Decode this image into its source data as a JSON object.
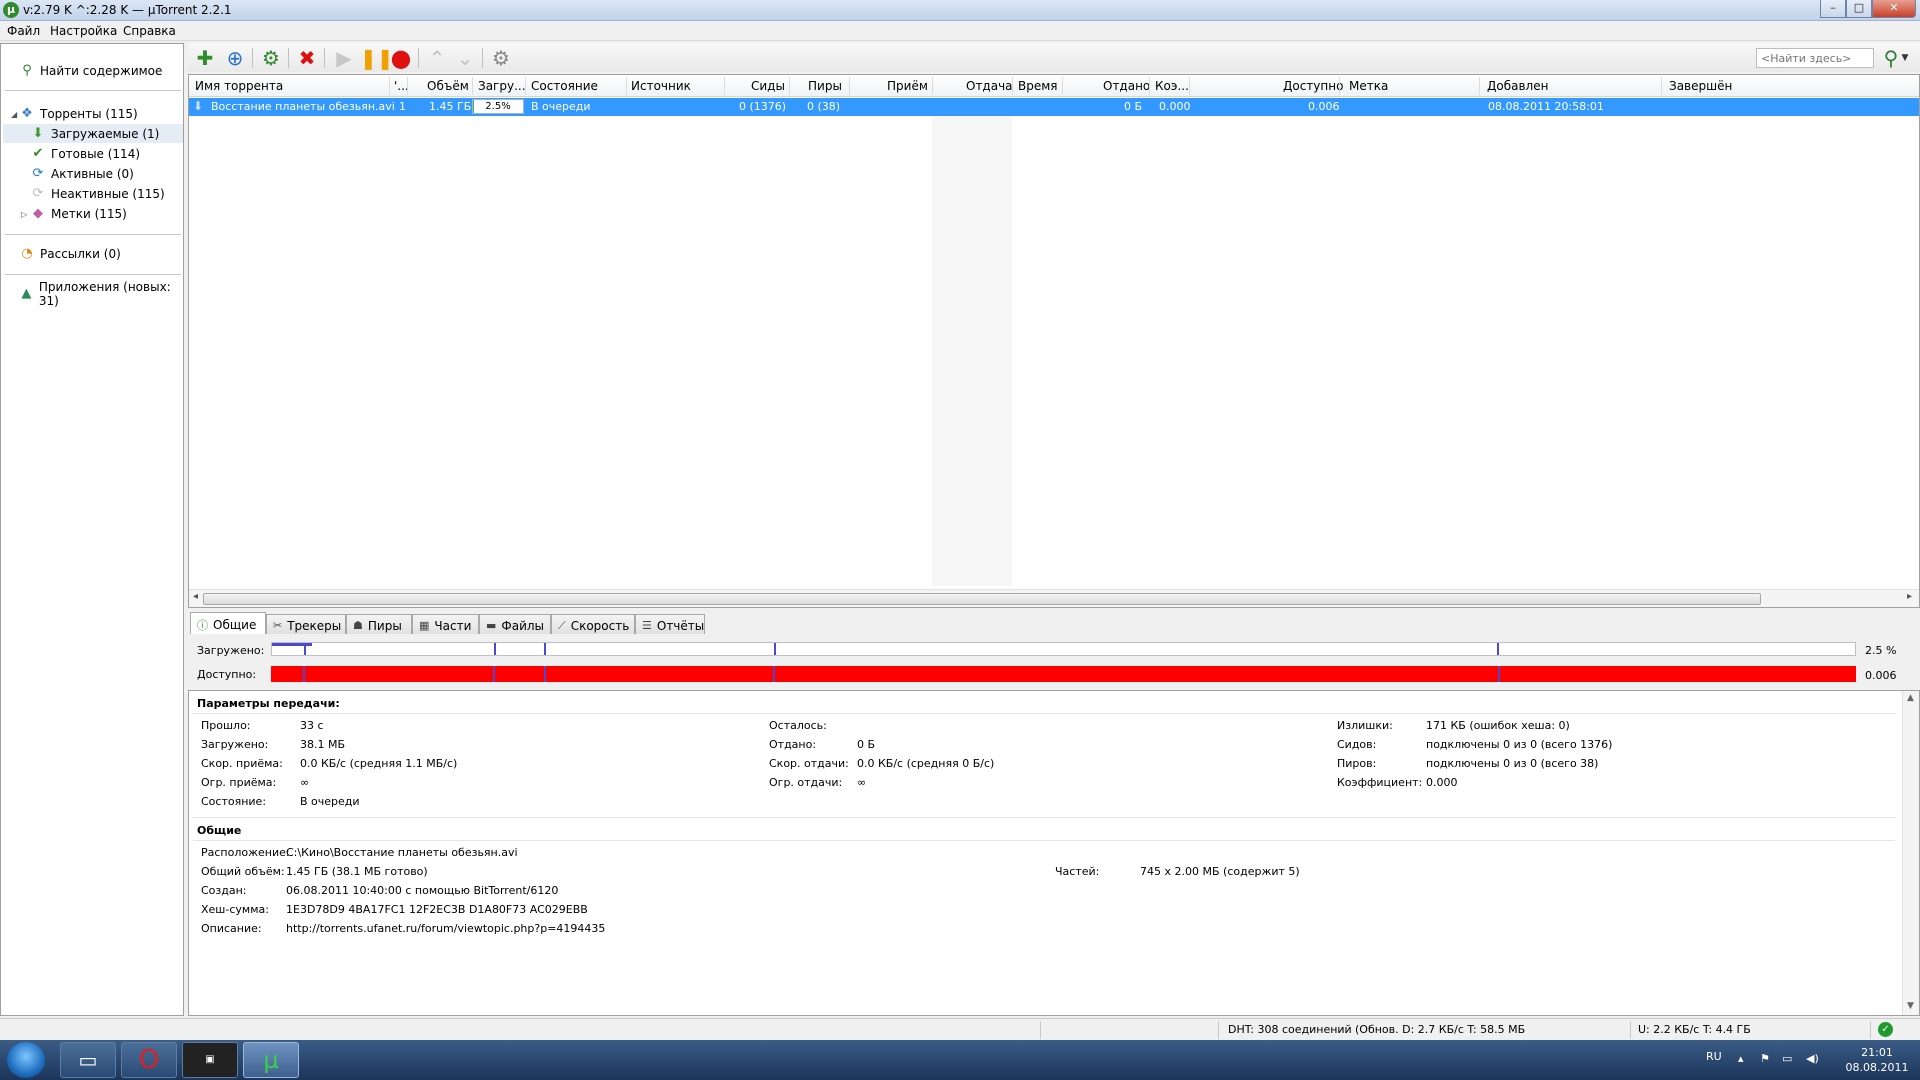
{
  "window": {
    "title": "v:2.79 K ^:2.28 K — µTorrent 2.2.1",
    "app_icon": "µ",
    "min": "–",
    "max": "□",
    "close": "✕"
  },
  "menu": [
    "Файл",
    "Настройка",
    "Справка"
  ],
  "sidebar": {
    "find": "Найти содержимое",
    "torrents": "Торренты (115)",
    "items": [
      {
        "label": "Загружаемые (1)",
        "icon": "arrow-down-icon",
        "glyph": "⬇",
        "color": "#3a9a2a"
      },
      {
        "label": "Готовые (114)",
        "icon": "checkmark-icon",
        "glyph": "✔",
        "color": "#2e8b1e"
      },
      {
        "label": "Активные (0)",
        "icon": "refresh-icon",
        "glyph": "⟳",
        "color": "#1e78c8"
      },
      {
        "label": "Неактивные (115)",
        "icon": "inactive-icon",
        "glyph": "⟳",
        "color": "#bbbbbb"
      },
      {
        "label": "Метки (115)",
        "icon": "tag-icon",
        "glyph": "◆",
        "color": "#c060a0"
      }
    ],
    "feeds": "Рассылки (0)",
    "apps": "Приложения (новых: 31)"
  },
  "toolbar": {
    "search_placeholder": "<Найти здесь>"
  },
  "list": {
    "columns": [
      "Имя торрента",
      "'...",
      "Объём",
      "Загру...",
      "Состояние",
      "Источник",
      "Сиды",
      "Пиры",
      "Приём",
      "Отдача",
      "Время",
      "Отдано",
      "Коэ...",
      "Доступно",
      "Метка",
      "Добавлен",
      "Завершён"
    ],
    "row": {
      "name": "Восстание планеты обезьян.avi",
      "num": "1",
      "size": "1.45 ГБ",
      "progress_label": "2.5%",
      "progress": 0.025,
      "status": "В очереди",
      "seeds": "0 (1376)",
      "peers": "0 (38)",
      "uploaded": "0 Б",
      "ratio": "0.000",
      "avail": "0.006",
      "added": "08.08.2011 20:58:01"
    }
  },
  "tabs": [
    "Общие",
    "Трекеры",
    "Пиры",
    "Части",
    "Файлы",
    "Скорость",
    "Отчёты"
  ],
  "pieces": {
    "done_label": "Загружено:",
    "avail_label": "Доступно:",
    "done_value": "2.5 %",
    "avail_value": "0.006"
  },
  "details": {
    "transfer_title": "Параметры передачи:",
    "col1": [
      {
        "k": "Прошло:",
        "v": "33 с"
      },
      {
        "k": "Загружено:",
        "v": "38.1 МБ"
      },
      {
        "k": "Скор. приёма:",
        "v": "0.0 КБ/с (средняя 1.1 МБ/с)"
      },
      {
        "k": "Огр. приёма:",
        "v": "∞"
      },
      {
        "k": "Состояние:",
        "v": "В очереди"
      }
    ],
    "col2": [
      {
        "k": "Осталось:",
        "v": ""
      },
      {
        "k": "Отдано:",
        "v": "0 Б"
      },
      {
        "k": "Скор. отдачи:",
        "v": "0.0 КБ/с (средняя 0 Б/с)"
      },
      {
        "k": "Огр. отдачи:",
        "v": "∞"
      }
    ],
    "col3": [
      {
        "k": "Излишки:",
        "v": "171 КБ (ошибок хеша: 0)"
      },
      {
        "k": "Сидов:",
        "v": "подключены 0 из 0 (всего 1376)"
      },
      {
        "k": "Пиров:",
        "v": "подключены 0 из 0 (всего 38)"
      },
      {
        "k": "Коэффициент:",
        "v": "0.000"
      }
    ],
    "general_title": "Общие",
    "general": [
      {
        "k": "Расположение:",
        "v": "C:\\Кино\\Восстание планеты обезьян.avi"
      },
      {
        "k": "Общий объём:",
        "v": "1.45 ГБ (38.1 МБ готово)"
      },
      {
        "k": "Создан:",
        "v": "06.08.2011 10:40:00 с помощью BitTorrent/6120"
      },
      {
        "k": "Хеш-сумма:",
        "v": "1E3D78D9 4BA17FC1 12F2EC3B D1A80F73 AC029EBB"
      },
      {
        "k": "Описание:",
        "v": "http://torrents.ufanet.ru/forum/viewtopic.php?p=4194435"
      }
    ],
    "pieces_k": "Частей:",
    "pieces_v": "745 x 2.00 МБ (содержит 5)"
  },
  "status": {
    "dht": "DHT: 308 соединений",
    "down": "(Обнов. D: 2.7 КБ/с T: 58.5 МБ",
    "up": "U: 2.2 КБ/с T: 4.4 ГБ"
  },
  "taskbar": {
    "lang": "RU",
    "time": "21:01",
    "date": "08.08.2011"
  }
}
